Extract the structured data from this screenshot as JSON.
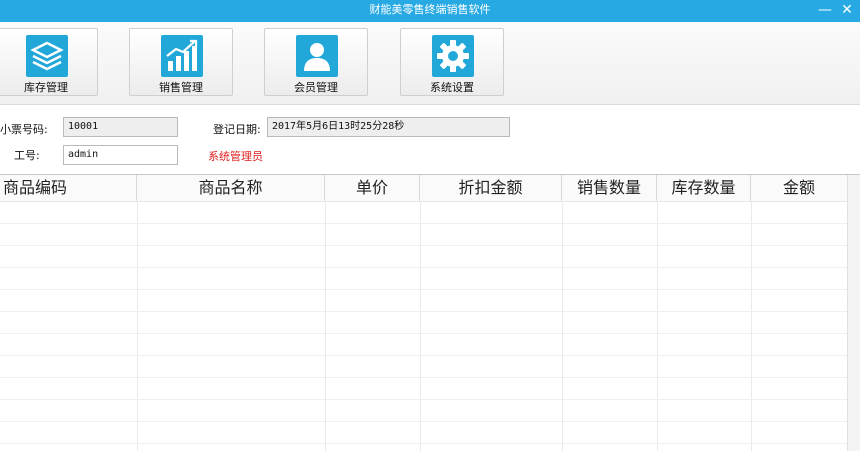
{
  "window": {
    "title": "财能美零售终端销售软件",
    "minimize_glyph": "—",
    "close_glyph": "✕"
  },
  "toolbar": {
    "items": [
      {
        "label": "库存管理",
        "icon": "stack-layers-icon"
      },
      {
        "label": "销售管理",
        "icon": "bar-chart-icon"
      },
      {
        "label": "会员管理",
        "icon": "user-icon"
      },
      {
        "label": "系统设置",
        "icon": "gear-icon"
      }
    ],
    "icon_color": "#22a8d8"
  },
  "form": {
    "receipt_label": "小票号码:",
    "receipt_value": "10001",
    "date_label": "登记日期:",
    "date_value": "2017年5月6日13时25分28秒",
    "staff_label": "工号:",
    "staff_value": "admin",
    "role_text": "系统管理员",
    "role_color": "#e02020"
  },
  "table": {
    "columns": [
      "商品编码",
      "商品名称",
      "单价",
      "折扣金额",
      "销售数量",
      "库存数量",
      "金额"
    ],
    "rows": []
  }
}
